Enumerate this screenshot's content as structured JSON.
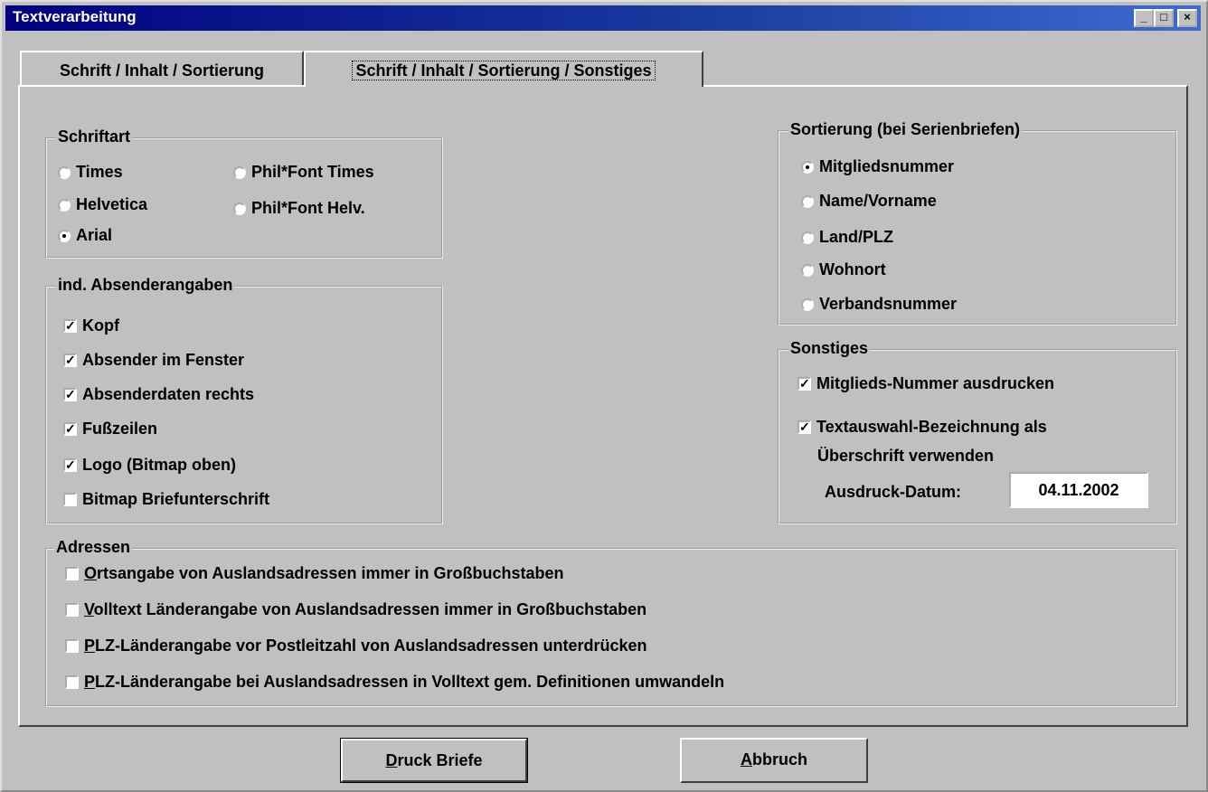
{
  "window": {
    "title": "Textverarbeitung",
    "controls": [
      "_",
      "□",
      "×"
    ]
  },
  "tabs": [
    {
      "label": "Schrift / Inhalt / Sortierung"
    },
    {
      "label": "Schrift / Inhalt / Sortierung / Sonstiges"
    }
  ],
  "schriftart": {
    "legend": "Schriftart",
    "options": [
      "Times",
      "Helvetica",
      "Arial",
      "Phil*Font Times",
      "Phil*Font Helv."
    ],
    "selected": "Arial"
  },
  "absender": {
    "legend": "ind. Absenderangaben",
    "items": [
      {
        "label": "Kopf",
        "checked": true
      },
      {
        "label": "Absender im Fenster",
        "checked": true
      },
      {
        "label": "Absenderdaten rechts",
        "checked": true
      },
      {
        "label": "Fußzeilen",
        "checked": true
      },
      {
        "label": "Logo (Bitmap oben)",
        "checked": true
      },
      {
        "label": "Bitmap Briefunterschrift",
        "checked": false
      }
    ]
  },
  "sortierung": {
    "legend": "Sortierung (bei Serienbriefen)",
    "options": [
      "Mitgliedsnummer",
      "Name/Vorname",
      "Land/PLZ",
      "Wohnort",
      "Verbandsnummer"
    ],
    "selected": "Mitgliedsnummer"
  },
  "sonstiges": {
    "legend": "Sonstiges",
    "items": [
      {
        "label": "Mitglieds-Nummer ausdrucken",
        "checked": true
      },
      {
        "label": "Textauswahl-Bezeichnung als",
        "label2": "Überschrift verwenden",
        "checked": true
      }
    ],
    "datum_label": "Ausdruck-Datum:",
    "datum_value": "04.11.2002"
  },
  "adressen": {
    "legend": "Adressen",
    "items": [
      {
        "label_u": "O",
        "label_rest": "rtsangabe von Auslandsadressen immer in Großbuchstaben",
        "checked": false
      },
      {
        "label_u": "V",
        "label_rest": "olltext Länderangabe von Auslandsadressen immer in Großbuchstaben",
        "checked": false
      },
      {
        "label_u": "P",
        "label_rest": "LZ-Länderangabe vor Postleitzahl von Auslandsadressen unterdrücken",
        "checked": false
      },
      {
        "label_u": "P",
        "label_rest": "LZ-Länderangabe bei Auslandsadressen in Volltext gem. Definitionen umwandeln",
        "checked": false
      }
    ]
  },
  "buttons": {
    "druck": {
      "label_u": "D",
      "label_rest": "ruck Briefe"
    },
    "abbruch": {
      "label_u": "A",
      "label_rest": "bbruch"
    }
  }
}
